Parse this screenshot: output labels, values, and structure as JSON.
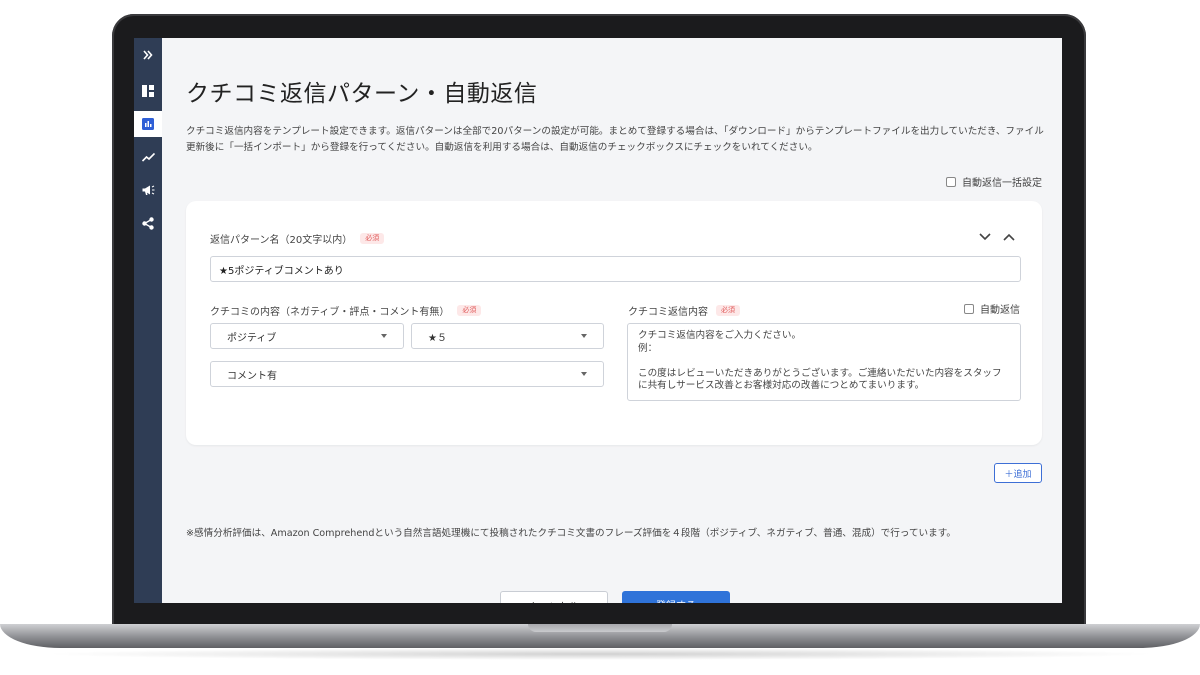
{
  "sidebar": {
    "items": [
      {
        "name": "expand",
        "icon": "double-chevron-right-icon"
      },
      {
        "name": "dashboard",
        "icon": "dashboard-icon"
      },
      {
        "name": "analytics",
        "icon": "bar-chart-icon",
        "active": true
      },
      {
        "name": "trend",
        "icon": "line-chart-icon"
      },
      {
        "name": "campaign",
        "icon": "megaphone-icon"
      },
      {
        "name": "share",
        "icon": "share-icon"
      }
    ]
  },
  "page": {
    "title": "クチコミ返信パターン・自動返信",
    "description": "クチコミ返信内容をテンプレート設定できます。返信パターンは全部で20パターンの設定が可能。まとめて登録する場合は、「ダウンロード」からテンプレートファイルを出力していただき、ファイル更新後に「一括インポート」から登録を行ってください。自動返信を利用する場合は、自動返信のチェックボックスにチェックをいれてください。",
    "bulk_auto_reply_label": "自動返信一括設定"
  },
  "pattern": {
    "name_label": "返信パターン名（20文字以内）",
    "required_badge": "必須",
    "name_value": "★5ポジティブコメントあり",
    "content_label": "クチコミの内容（ネガティブ・評点・コメント有無）",
    "sentiment_value": "ポジティブ",
    "rating_value": "★５",
    "comment_value": "コメント有",
    "reply_label": "クチコミ返信内容",
    "auto_reply_label": "自動返信",
    "reply_placeholder": "クチコミ返信内容をご入力ください。\n例：\n\nこの度はレビューいただきありがとうございます。ご連絡いただいた内容をスタッフに共有しサービス改善とお客様対応の改善につとめてまいります。"
  },
  "actions": {
    "add_label": "＋追加",
    "cancel_label": "キャンセル",
    "submit_label": "登録する"
  },
  "footer_note": "※感情分析評価は、Amazon Comprehendという自然言語処理機にて投稿されたクチコミ文書のフレーズ評価を４段階（ポジティブ、ネガティブ、普通、混成）で行っています。",
  "colors": {
    "sidebar": "#2f3d55",
    "accent": "#2f73d9",
    "required": "#e05a5a",
    "background": "#f4f5f7"
  }
}
